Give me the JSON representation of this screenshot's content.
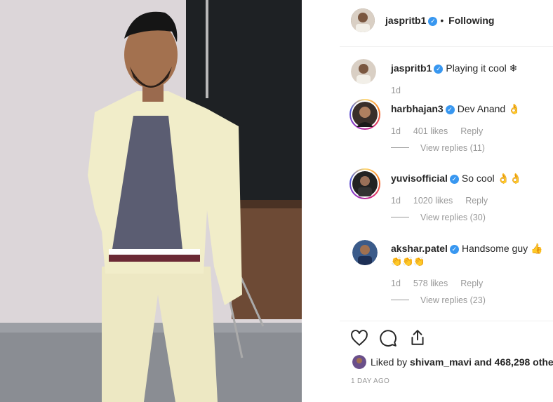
{
  "post": {
    "author": "jaspritb1",
    "follow_status": "Following",
    "separator": "•",
    "caption_author": "jaspritb1",
    "caption_text": "Playing it cool ❄",
    "caption_time": "1d",
    "verified_icon": "✓"
  },
  "comments": [
    {
      "user": "harbhajan3",
      "text": "Dev Anand 👌",
      "time": "1d",
      "likes": "401 likes",
      "reply": "Reply",
      "view_replies": "View replies (11)"
    },
    {
      "user": "yuvisofficial",
      "text": "So cool 👌👌",
      "time": "1d",
      "likes": "1020 likes",
      "reply": "Reply",
      "view_replies": "View replies (30)"
    },
    {
      "user": "akshar.patel",
      "text": "Handsome guy 👍",
      "text2": "👏👏👏",
      "time": "1d",
      "likes": "578 likes",
      "reply": "Reply",
      "view_replies": "View replies (23)"
    }
  ],
  "actions": {
    "like_icon": "heart-icon",
    "comment_icon": "comment-icon",
    "share_icon": "share-icon"
  },
  "likes": {
    "prefix": "Liked by",
    "user": "shivam_mavi",
    "suffix": "and 468,298 othe"
  },
  "timestamp": "1 DAY AGO",
  "colors": {
    "verified": "#3897f0",
    "muted": "#999999",
    "text": "#262626"
  }
}
